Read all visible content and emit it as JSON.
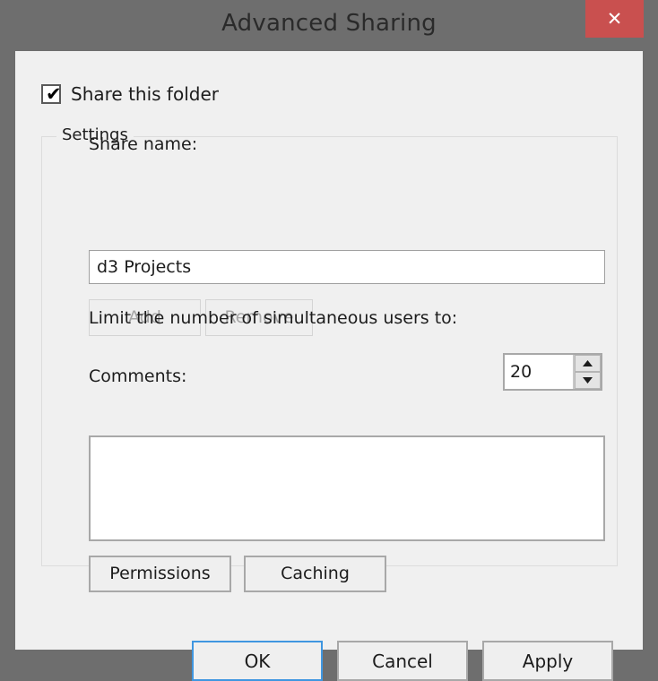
{
  "window": {
    "title": "Advanced Sharing",
    "close_label": "✕",
    "titlebar_color": "#6e6e6e",
    "close_button_color": "#c9504f",
    "client_background": "#f0f0f0"
  },
  "share_folder": {
    "label": "Share this folder",
    "checked": true,
    "check_glyph": "✔"
  },
  "settings": {
    "legend": "Settings",
    "share_name": {
      "label": "Share name:",
      "value": "d3 Projects",
      "placeholder": ""
    },
    "add_button": {
      "label": "Add",
      "enabled": false
    },
    "remove_button": {
      "label": "Remove",
      "enabled": false
    },
    "user_limit": {
      "label": "Limit the number of simultaneous users to:",
      "value": "20"
    },
    "comments": {
      "label": "Comments:",
      "value": "",
      "placeholder": ""
    },
    "permissions_button": "Permissions",
    "caching_button": "Caching"
  },
  "footer": {
    "ok_label": "OK",
    "cancel_label": "Cancel",
    "apply_label": "Apply",
    "focus_color": "#3f96e0"
  }
}
